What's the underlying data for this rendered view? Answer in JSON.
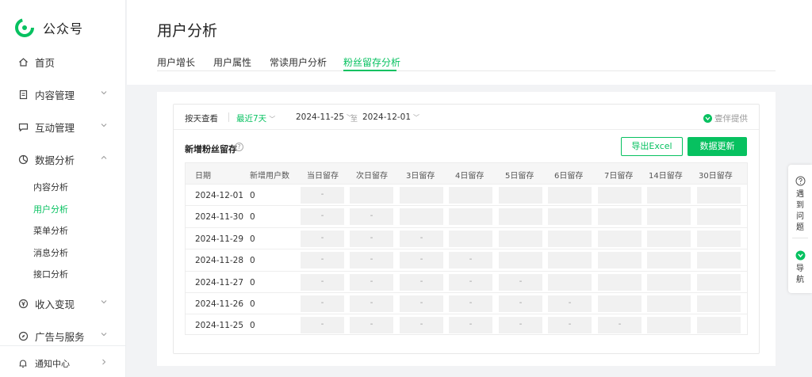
{
  "app": {
    "title": "公众号"
  },
  "sidebar": {
    "items": [
      {
        "label": "首页",
        "icon": "home-icon"
      },
      {
        "label": "内容管理",
        "icon": "document-icon"
      },
      {
        "label": "互动管理",
        "icon": "chat-icon"
      },
      {
        "label": "数据分析",
        "icon": "pie-chart-icon"
      },
      {
        "label": "收入变现",
        "icon": "yen-icon"
      },
      {
        "label": "广告与服务",
        "icon": "compass-icon"
      },
      {
        "label": "通知中心",
        "icon": "bell-icon"
      }
    ],
    "data_sub": [
      {
        "label": "内容分析"
      },
      {
        "label": "用户分析"
      },
      {
        "label": "菜单分析"
      },
      {
        "label": "消息分析"
      },
      {
        "label": "接口分析"
      }
    ]
  },
  "page": {
    "title": "用户分析"
  },
  "tabs": [
    "用户增长",
    "用户属性",
    "常读用户分析",
    "粉丝留存分析"
  ],
  "filter": {
    "view_by": "按天查看",
    "range": "最近7天",
    "start": "2024-11-25",
    "sep": "至",
    "end": "2024-12-01",
    "provider": "壹伴提供"
  },
  "section": {
    "title": "新增粉丝留存",
    "help": "?",
    "export_label": "导出Excel",
    "refresh_label": "数据更新"
  },
  "table": {
    "headers": [
      "日期",
      "新增用户数",
      "当日留存",
      "次日留存",
      "3日留存",
      "4日留存",
      "5日留存",
      "6日留存",
      "7日留存",
      "14日留存",
      "30日留存"
    ],
    "rows": [
      {
        "date": "2024-12-01",
        "count": "0",
        "cells": [
          "-",
          "",
          "",
          "",
          "",
          "",
          "",
          "",
          ""
        ]
      },
      {
        "date": "2024-11-30",
        "count": "0",
        "cells": [
          "-",
          "-",
          "",
          "",
          "",
          "",
          "",
          "",
          ""
        ]
      },
      {
        "date": "2024-11-29",
        "count": "0",
        "cells": [
          "-",
          "-",
          "-",
          "",
          "",
          "",
          "",
          "",
          ""
        ]
      },
      {
        "date": "2024-11-28",
        "count": "0",
        "cells": [
          "-",
          "-",
          "-",
          "-",
          "",
          "",
          "",
          "",
          ""
        ]
      },
      {
        "date": "2024-11-27",
        "count": "0",
        "cells": [
          "-",
          "-",
          "-",
          "-",
          "-",
          "",
          "",
          "",
          ""
        ]
      },
      {
        "date": "2024-11-26",
        "count": "0",
        "cells": [
          "-",
          "-",
          "-",
          "-",
          "-",
          "-",
          "",
          "",
          ""
        ]
      },
      {
        "date": "2024-11-25",
        "count": "0",
        "cells": [
          "-",
          "-",
          "-",
          "-",
          "-",
          "-",
          "-",
          "",
          ""
        ]
      }
    ]
  },
  "float_panel": {
    "problem_label": [
      "遇",
      "到",
      "问",
      "题"
    ],
    "nav_label": [
      "导",
      "航"
    ]
  },
  "colors": {
    "accent": "#07c160"
  }
}
